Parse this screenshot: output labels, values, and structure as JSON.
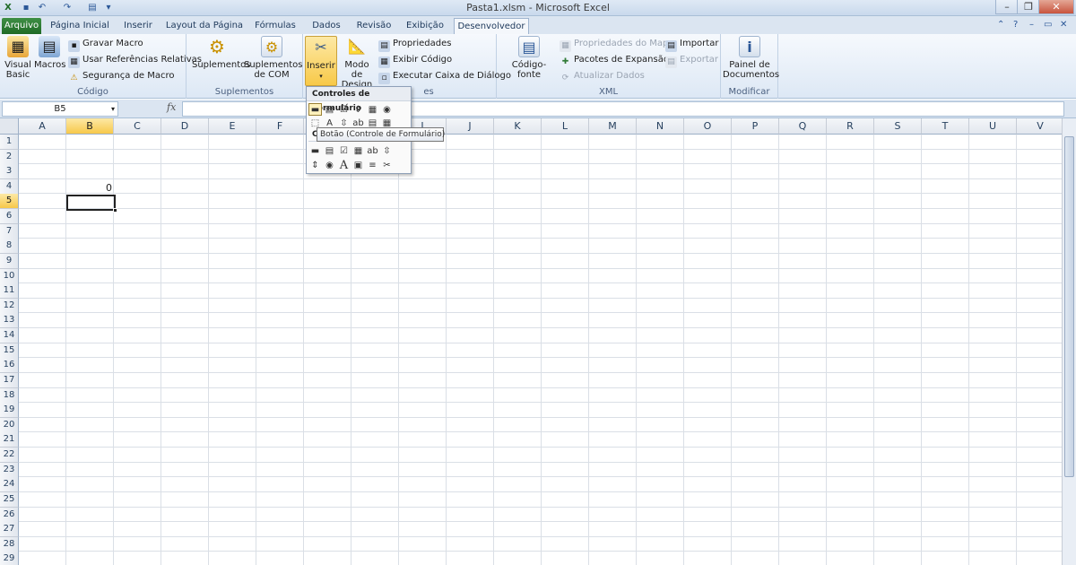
{
  "window": {
    "title": "Pasta1.xlsm - Microsoft Excel"
  },
  "tabs": [
    "Arquivo",
    "Página Inicial",
    "Inserir",
    "Layout da Página",
    "Fórmulas",
    "Dados",
    "Revisão",
    "Exibição",
    "Desenvolvedor"
  ],
  "ribbon": {
    "codigo": {
      "label": "Código",
      "visual_basic": "Visual Basic",
      "macros": "Macros",
      "gravar_macro": "Gravar Macro",
      "usar_referencias": "Usar Referências Relativas",
      "seguranca": "Segurança de Macro"
    },
    "suplementos": {
      "label": "Suplementos",
      "suplementos": "Suplementos",
      "suplementos_com": "Suplementos de COM"
    },
    "controles": {
      "label": "es",
      "inserir": "Inserir",
      "modo_design": "Modo de Design",
      "propriedades": "Propriedades",
      "exibir_codigo": "Exibir Código",
      "executar_caixa": "Executar Caixa de Diálogo"
    },
    "xml": {
      "label": "XML",
      "codigo_fonte": "Código-fonte",
      "propriedades_mapa": "Propriedades do Mapa",
      "pacotes_expansao": "Pacotes de Expansão",
      "atualizar_dados": "Atualizar Dados",
      "importar": "Importar",
      "exportar": "Exportar"
    },
    "modificar": {
      "label": "Modificar",
      "painel_documentos": "Painel de Documentos"
    }
  },
  "formula_bar": {
    "name_box": "B5",
    "fx": "fx",
    "value": ""
  },
  "grid": {
    "columns": [
      "A",
      "B",
      "C",
      "D",
      "E",
      "F",
      "G",
      "H",
      "I",
      "J",
      "K",
      "L",
      "M",
      "N",
      "O",
      "P",
      "Q",
      "R",
      "S",
      "T",
      "U",
      "V"
    ],
    "rows": [
      "1",
      "2",
      "3",
      "4",
      "5",
      "6",
      "7",
      "8",
      "9",
      "10",
      "11",
      "12",
      "13",
      "14",
      "15",
      "16",
      "17",
      "18",
      "19",
      "20",
      "21",
      "22",
      "23",
      "24",
      "25",
      "26",
      "27",
      "28",
      "29"
    ],
    "selected_cell": "B5",
    "cell_b4_value": "0"
  },
  "dropdown": {
    "header": "Controles de Formulário",
    "activex_header_fragment": "C",
    "tooltip": "Botão (Controle de Formulário)"
  },
  "colors": {
    "file_tab": "#2a6c2f",
    "selection_header": "#f7c84a",
    "ribbon_bg": "#dde8f5"
  }
}
